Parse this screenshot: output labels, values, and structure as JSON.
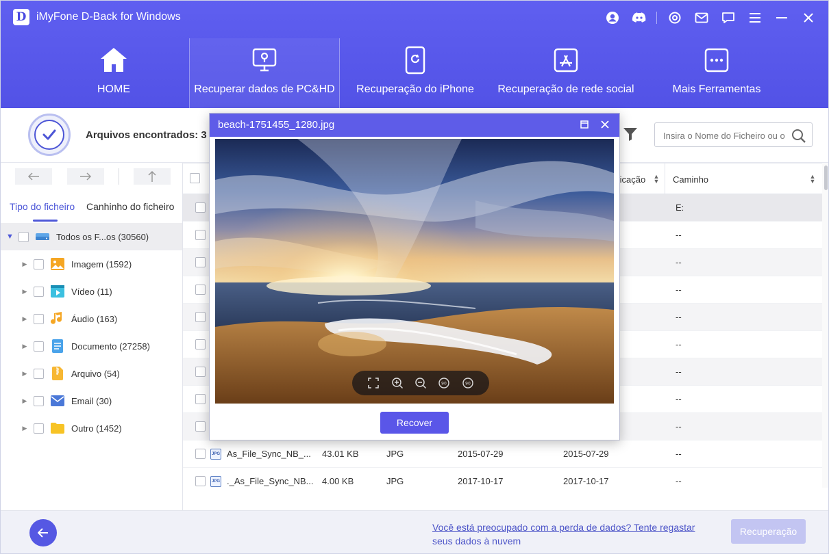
{
  "app": {
    "title": "iMyFone D-Back for Windows",
    "logo_letter": "D",
    "accent_color": "#5555e8"
  },
  "titlebar_icons": [
    "user-icon",
    "discord-icon",
    "settings-icon",
    "mail-icon",
    "chat-icon",
    "menu-icon",
    "minimize-icon",
    "close-icon"
  ],
  "nav": {
    "items": [
      {
        "label": "HOME",
        "icon": "home-icon"
      },
      {
        "label": "Recuperar dados de PC&HD",
        "icon": "pc-recovery-icon",
        "active": true
      },
      {
        "label": "Recuperação do iPhone",
        "icon": "iphone-icon"
      },
      {
        "label": "Recuperação de rede social",
        "icon": "appstore-icon"
      },
      {
        "label": "Mais Ferramentas",
        "icon": "more-tools-icon"
      }
    ]
  },
  "scan": {
    "found_label": "Arquivos encontrados: 3"
  },
  "search": {
    "placeholder": "Insira o Nome do Ficheiro ou o"
  },
  "left_panel": {
    "tabs": [
      "Tipo do ficheiro",
      "Canhinho do ficheiro"
    ],
    "active_tab": 0,
    "tree": [
      {
        "label": "Todos os F...os (30560)",
        "icon": "drive-icon",
        "root": true
      },
      {
        "label": "Imagem (1592)",
        "icon": "image-icon"
      },
      {
        "label": "Vídeo (11)",
        "icon": "video-icon"
      },
      {
        "label": "Áudio (163)",
        "icon": "audio-icon"
      },
      {
        "label": "Documento (27258)",
        "icon": "document-icon"
      },
      {
        "label": "Arquivo (54)",
        "icon": "archive-icon"
      },
      {
        "label": "Email (30)",
        "icon": "email-icon"
      },
      {
        "label": "Outro (1452)",
        "icon": "folder-icon"
      }
    ]
  },
  "table": {
    "headers": {
      "modified": "ficação",
      "path": "Caminho"
    },
    "rows": [
      {
        "path": "E:",
        "selected": true
      },
      {
        "path": "--"
      },
      {
        "path": "--"
      },
      {
        "path": "--"
      },
      {
        "path": "--"
      },
      {
        "path": "--"
      },
      {
        "path": "--"
      },
      {
        "path": "--"
      },
      {
        "path": "--"
      },
      {
        "name": "As_File_Sync_NB_...",
        "size": "43.01 KB",
        "type": "JPG",
        "created": "2015-07-29",
        "modified": "2015-07-29",
        "path": "--"
      },
      {
        "name": "._As_File_Sync_NB...",
        "size": "4.00 KB",
        "type": "JPG",
        "created": "2017-10-17",
        "modified": "2017-10-17",
        "path": "--"
      }
    ]
  },
  "preview": {
    "title": "beach-1751455_1280.jpg",
    "recover_label": "Recover",
    "tools": [
      "fullscreen-icon",
      "zoom-in-icon",
      "zoom-out-icon",
      "rotate-left-icon",
      "rotate-right-icon"
    ]
  },
  "bottom": {
    "cloud_line1": "Você está preocupado com a perda de dados? Tente regastar",
    "cloud_line2": "seus dados à nuvem",
    "recover_label": "Recuperação"
  }
}
